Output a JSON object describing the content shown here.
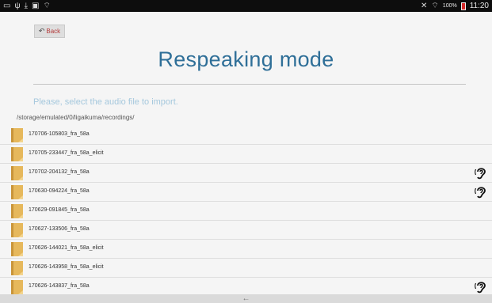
{
  "status_bar": {
    "battery_percent": "100%",
    "time": "11:20",
    "left_icons": [
      "cast-icon",
      "usb-icon",
      "download-icon",
      "image-icon",
      "wifi-icon"
    ],
    "right_icons": [
      "mute-icon",
      "wifi-icon",
      "battery-icon"
    ]
  },
  "back_button": {
    "label": "Back"
  },
  "title": "Respeaking mode",
  "instruction": "Please, select the audio file to import.",
  "path": "/storage/emulated/0/ligaikuma/recordings/",
  "files": [
    {
      "name": "170706-105803_fra_58a",
      "listened": false
    },
    {
      "name": "170705-233447_fra_58a_elicit",
      "listened": false
    },
    {
      "name": "170702-204132_fra_58a",
      "listened": true
    },
    {
      "name": "170630-094224_fra_58a",
      "listened": true
    },
    {
      "name": "170629-091845_fra_58a",
      "listened": false
    },
    {
      "name": "170627-133506_fra_58a",
      "listened": false
    },
    {
      "name": "170626-144021_fra_58a_elicit",
      "listened": false
    },
    {
      "name": "170626-143958_fra_58a_elicit",
      "listened": false
    },
    {
      "name": "170626-143837_fra_58a",
      "listened": true
    }
  ],
  "colors": {
    "title": "#2f6f98",
    "instruction": "#a5c8dd",
    "back_text": "#b33a3a",
    "folder": "#e6b85c"
  }
}
